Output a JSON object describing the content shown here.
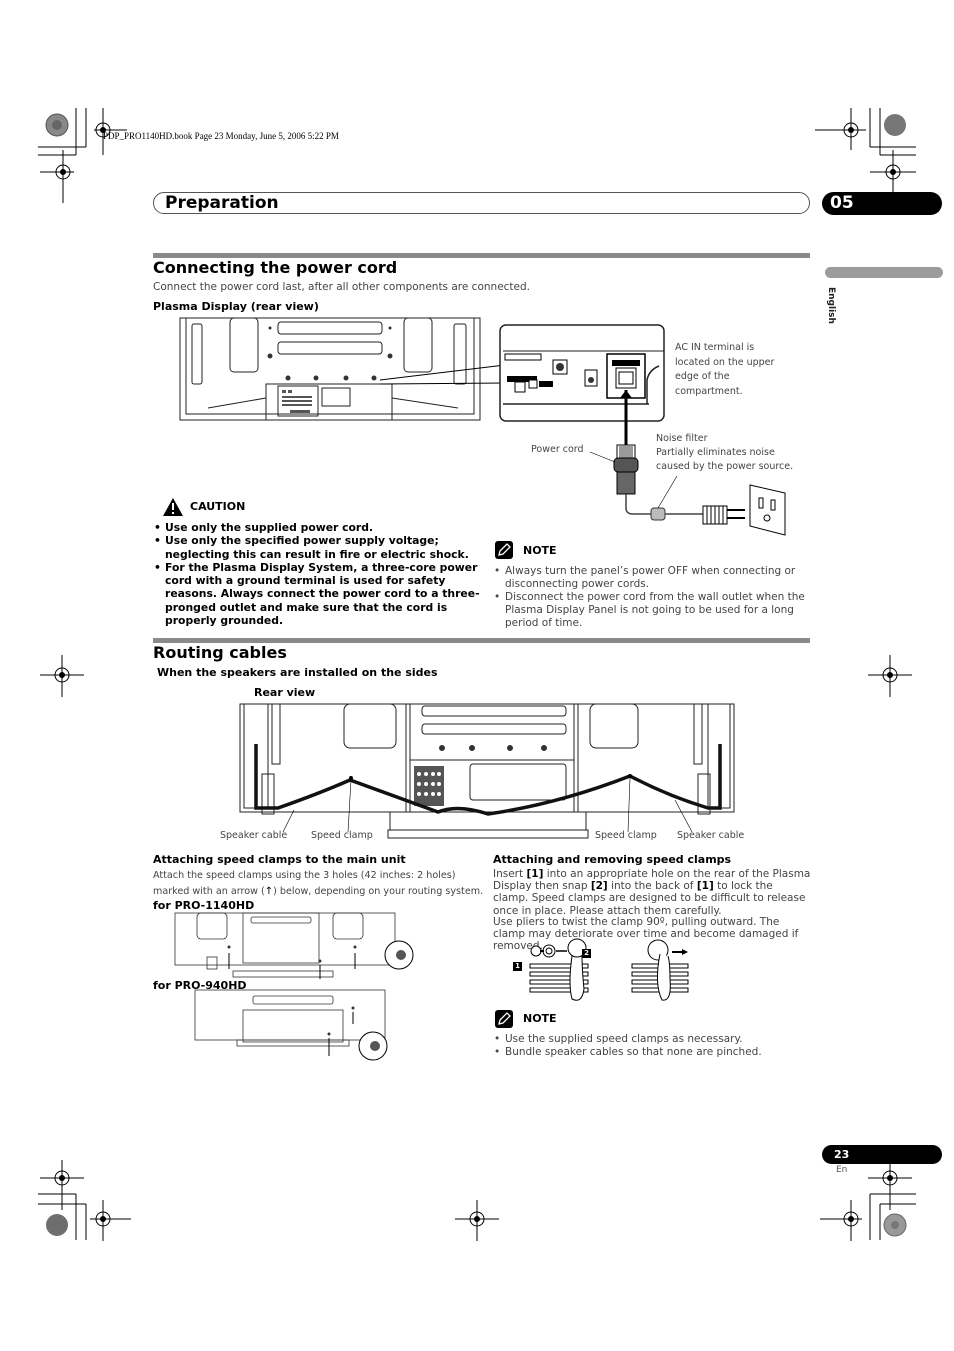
{
  "print_slug": "PDP_PRO1140HD.book  Page 23  Monday, June 5, 2006  5:22 PM",
  "header": {
    "title": "Preparation",
    "chapter": "05"
  },
  "side_tab": {
    "language": "English"
  },
  "power_cord": {
    "heading": "Connecting the power cord",
    "intro": "Connect the power cord last, after all other components are connected.",
    "figure_title": "Plasma Display (rear view)",
    "callouts": {
      "ac_in": [
        "AC IN terminal is",
        "located on the upper",
        "edge of the",
        "compartment."
      ],
      "power_cord": "Power cord",
      "noise_filter": [
        "Noise filter",
        "Partially eliminates noise",
        "caused by the power source."
      ]
    },
    "caution": {
      "label": "CAUTION",
      "items": [
        "Use only the supplied power cord.",
        "Use only the specified power supply voltage; neglecting this can result in fire or electric shock.",
        "For the Plasma Display System, a three-core power cord with a ground terminal is used for safety reasons. Always connect the power cord to a three-pronged outlet and make sure that the cord is properly grounded."
      ]
    },
    "note": {
      "label": "NOTE",
      "items": [
        "Always turn the panel’s power OFF when connecting or disconnecting power cords.",
        "Disconnect the power cord from the wall outlet when the Plasma Display Panel is not going to be used for a long period of time."
      ]
    }
  },
  "routing": {
    "heading": "Routing cables",
    "subheading": "When the speakers are installed on the sides",
    "figure_title": "Rear view",
    "callouts": [
      "Speaker cable",
      "Speed clamp",
      "Speed clamp",
      "Speaker cable"
    ],
    "attach_main": {
      "heading": "Attaching speed clamps to the main unit",
      "text_line1": "Attach the speed clamps using the 3 holes (42 inches: 2 holes)",
      "text_line2_pre": "marked with an arrow (",
      "text_line2_post": ") below, depending on your routing system.",
      "model_a": "for PRO-1140HD",
      "model_b": "for PRO-940HD"
    },
    "attach_remove": {
      "heading": "Attaching and removing speed clamps",
      "p1_a": "Insert ",
      "p1_b": "[1]",
      "p1_c": " into an appropriate hole on the rear of the Plasma Display then snap ",
      "p1_d": "[2]",
      "p1_e": " into the back of ",
      "p1_f": "[1]",
      "p1_g": " to lock the clamp. Speed clamps are designed to be difficult to release once in place. Please attach them carefully.",
      "p2": "Use pliers to twist the clamp 90º, pulling outward. The clamp may deteriorate over time and become damaged if removed.",
      "step1": "1",
      "step2": "2"
    },
    "note": {
      "label": "NOTE",
      "items": [
        "Use the supplied speed clamps as necessary.",
        "Bundle speaker cables so that none are pinched."
      ]
    }
  },
  "footer": {
    "page_number": "23",
    "lang_code": "En"
  }
}
